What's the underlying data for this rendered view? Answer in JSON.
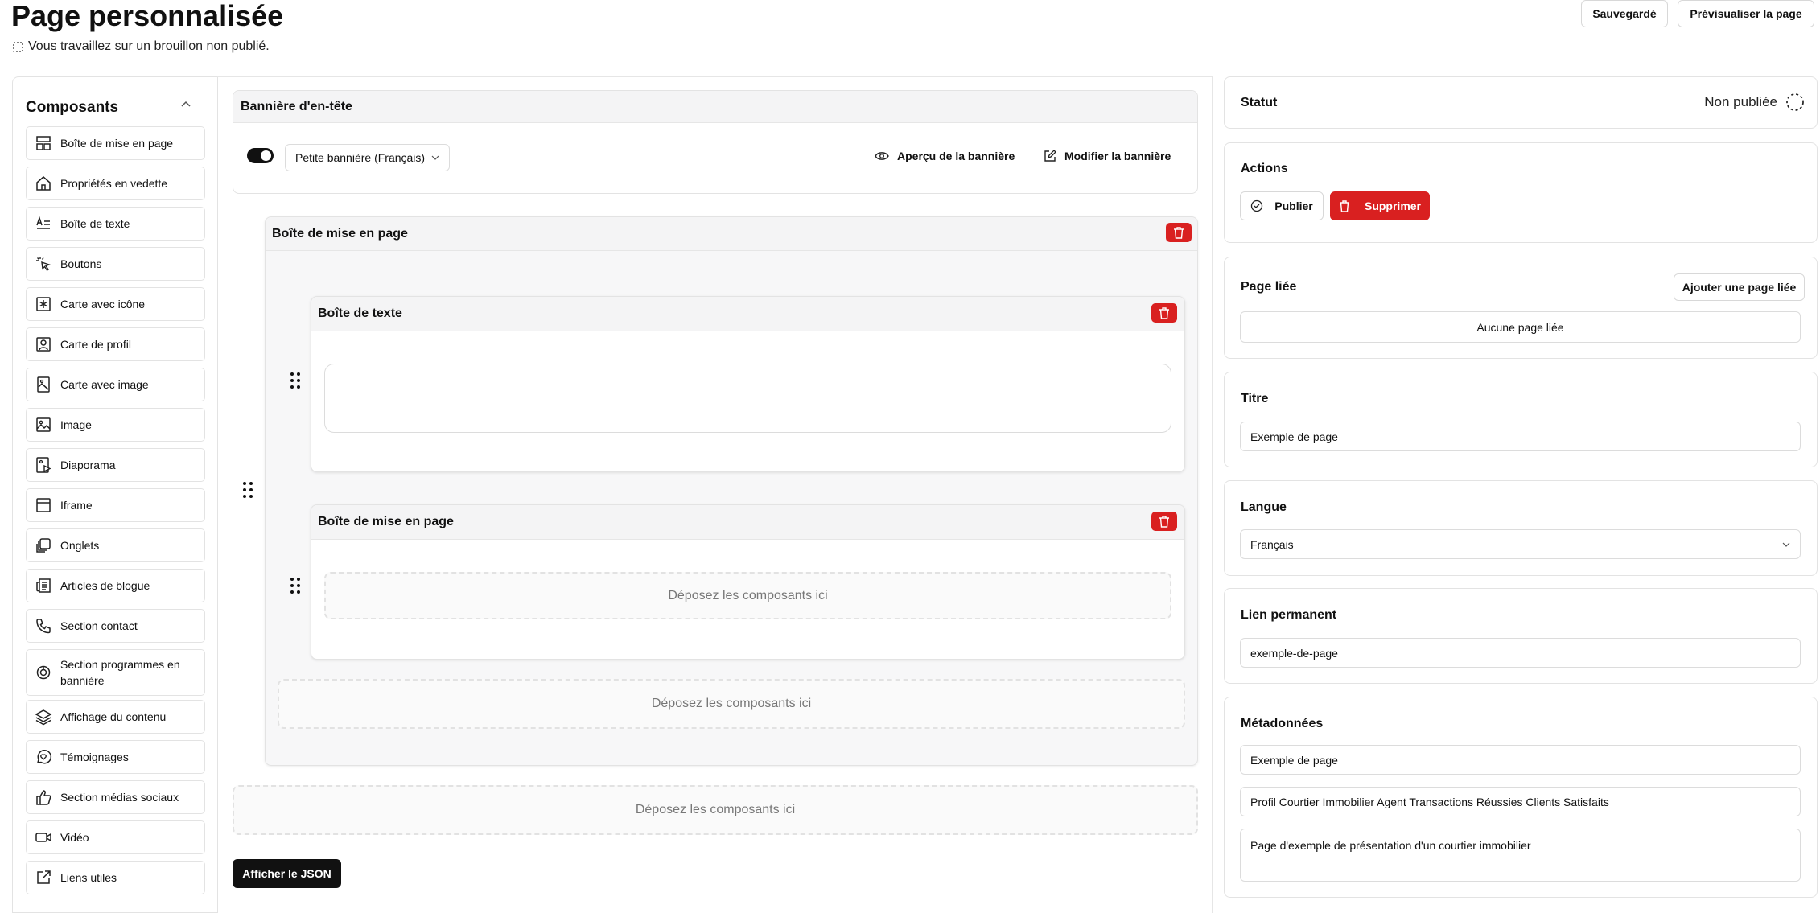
{
  "header": {
    "title": "Page personnalisée",
    "subtitle": "Vous travaillez sur un brouillon non publié.",
    "saved_label": "Sauvegardé",
    "preview_label": "Prévisualiser la page"
  },
  "sidebar": {
    "title": "Composants",
    "items": [
      {
        "label": "Boîte de mise en page",
        "icon": "layout-icon"
      },
      {
        "label": "Propriétés en vedette",
        "icon": "home-icon"
      },
      {
        "label": "Boîte de texte",
        "icon": "text-icon"
      },
      {
        "label": "Boutons",
        "icon": "pointer-click-icon"
      },
      {
        "label": "Carte avec icône",
        "icon": "star-card-icon"
      },
      {
        "label": "Carte de profil",
        "icon": "user-card-icon"
      },
      {
        "label": "Carte avec image",
        "icon": "image-card-icon"
      },
      {
        "label": "Image",
        "icon": "image-icon"
      },
      {
        "label": "Diaporama",
        "icon": "slideshow-icon"
      },
      {
        "label": "Iframe",
        "icon": "iframe-icon"
      },
      {
        "label": "Onglets",
        "icon": "tabs-icon"
      },
      {
        "label": "Articles de blogue",
        "icon": "newspaper-icon"
      },
      {
        "label": "Section contact",
        "icon": "phone-icon"
      },
      {
        "label": "Section programmes en bannière",
        "icon": "badge-icon"
      },
      {
        "label": "Affichage du contenu",
        "icon": "layers-icon"
      },
      {
        "label": "Témoignages",
        "icon": "heart-message-icon"
      },
      {
        "label": "Section médias sociaux",
        "icon": "thumbs-up-icon"
      },
      {
        "label": "Vidéo",
        "icon": "video-icon"
      },
      {
        "label": "Liens utiles",
        "icon": "external-link-icon"
      }
    ]
  },
  "editor": {
    "banner": {
      "title": "Bannière d'en-tête",
      "select_value": "Petite bannière (Français)",
      "preview_label": "Aperçu de la bannière",
      "edit_label": "Modifier la bannière"
    },
    "layout_box_title": "Boîte de mise en page",
    "text_box_title": "Boîte de texte",
    "inner_layout_box_title": "Boîte de mise en page",
    "drop_label": "Déposez les composants ici",
    "json_button": "Afficher le JSON"
  },
  "right": {
    "status": {
      "label": "Statut",
      "value": "Non publiée"
    },
    "actions": {
      "label": "Actions",
      "publish": "Publier",
      "delete": "Supprimer"
    },
    "linked_page": {
      "label": "Page liée",
      "add": "Ajouter une page liée",
      "empty": "Aucune page liée"
    },
    "title": {
      "label": "Titre",
      "value": "Exemple de page"
    },
    "language": {
      "label": "Langue",
      "value": "Français"
    },
    "permalink": {
      "label": "Lien permanent",
      "value": "exemple-de-page"
    },
    "metadata": {
      "label": "Métadonnées",
      "title_value": "Exemple de page",
      "keywords_value": "Profil Courtier Immobilier Agent Transactions Réussies Clients Satisfaits",
      "description_value": "Page d'exemple de présentation d'un courtier immobilier"
    }
  },
  "colors": {
    "danger": "#d92020",
    "dark": "#111111",
    "border": "#e3e3e3"
  }
}
